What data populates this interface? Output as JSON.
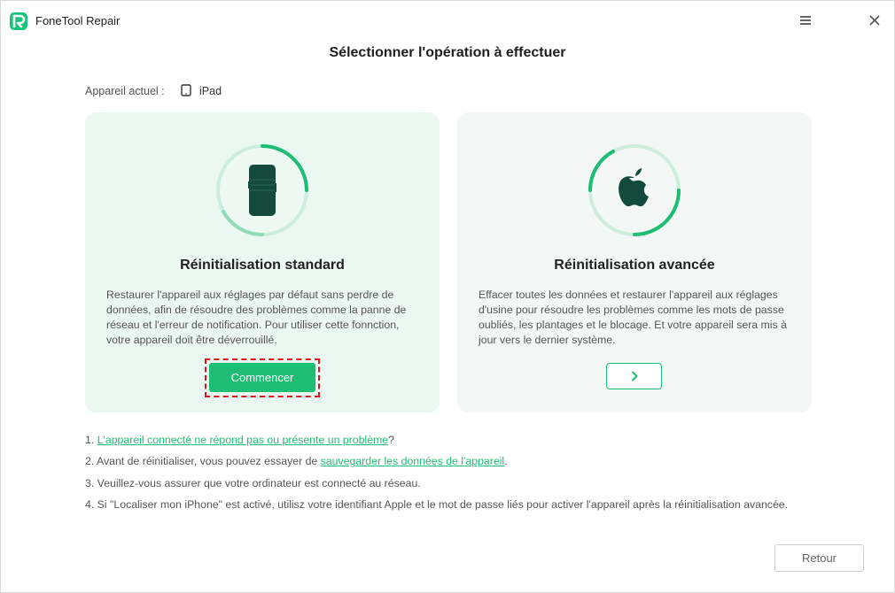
{
  "app": {
    "title": "FoneTool Repair"
  },
  "page": {
    "title": "Sélectionner l'opération à effectuer"
  },
  "device": {
    "label": "Appareil actuel :",
    "name": "iPad",
    "icon": "tablet-icon"
  },
  "colors": {
    "accent": "#1dbd74",
    "highlight": "#e0141e",
    "card_standard_bg": "#eaf8f1",
    "card_advanced_bg": "#f3f7f6"
  },
  "cards": {
    "standard": {
      "icon": "phone-icon",
      "title": "Réinitialisation standard",
      "description": "Restaurer l'appareil aux réglages par défaut sans perdre de données, afin de résoudre des problèmes comme la panne de réseau et l'erreur de notification. Pour utiliser cette fonnction, votre appareil doit être déverrouillé.",
      "button_label": "Commencer"
    },
    "advanced": {
      "icon": "apple-icon",
      "title": "Réinitialisation avancée",
      "description": "Effacer toutes les données et restaurer l'appareil aux réglages d'usine pour résoudre les problèmes comme les mots de passe oubliés, les plantages et le blocage. Et votre appareil sera mis à jour vers le dernier système.",
      "button_icon": "chevron-right-icon"
    }
  },
  "notes": [
    {
      "prefix": "1. ",
      "link": "L'appareil connecté ne répond pas ou présente un problème",
      "suffix": "?"
    },
    {
      "prefix": "2. Avant de réinitialiser, vous pouvez essayer de ",
      "link": "sauvegarder les données de l'appareil",
      "suffix": "."
    },
    {
      "prefix": "3. Veuillez-vous assurer que votre ordinateur est connecté au réseau.",
      "link": "",
      "suffix": ""
    },
    {
      "prefix": "4. Si \"Localiser mon iPhone\" est activé, utilisz votre identifiant Apple et le mot de passe liés pour activer l'appareil après la réinitialisation avancée.",
      "link": "",
      "suffix": ""
    }
  ],
  "footer": {
    "back_label": "Retour"
  }
}
